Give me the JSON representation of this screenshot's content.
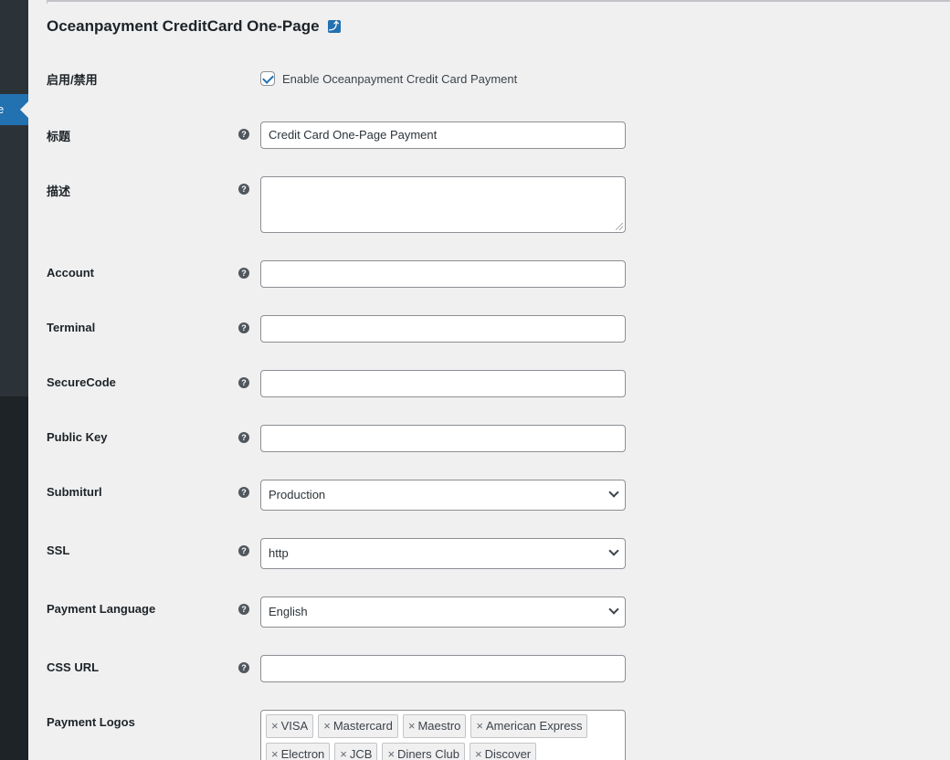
{
  "sidebar": {
    "current_item_fragment": "e"
  },
  "page": {
    "title": "Oceanpayment CreditCard One-Page",
    "back_icon_glyph": "⤴"
  },
  "help_glyph": "?",
  "fields": {
    "enable": {
      "label": "启用/禁用",
      "checkbox_label": "Enable Oceanpayment Credit Card Payment",
      "checked": true
    },
    "title": {
      "label": "标题",
      "value": "Credit Card One-Page Payment"
    },
    "description": {
      "label": "描述",
      "value": ""
    },
    "account": {
      "label": "Account",
      "value": ""
    },
    "terminal": {
      "label": "Terminal",
      "value": ""
    },
    "securecode": {
      "label": "SecureCode",
      "value": ""
    },
    "public_key": {
      "label": "Public Key",
      "value": ""
    },
    "submiturl": {
      "label": "Submiturl",
      "value": "Production"
    },
    "ssl": {
      "label": "SSL",
      "value": "http"
    },
    "payment_language": {
      "label": "Payment Language",
      "value": "English"
    },
    "css_url": {
      "label": "CSS URL",
      "value": ""
    },
    "payment_logos": {
      "label": "Payment Logos",
      "remove_glyph": "×",
      "tags": [
        "VISA",
        "Mastercard",
        "Maestro",
        "American Express",
        "Electron",
        "JCB",
        "Diners Club",
        "Discover"
      ]
    }
  },
  "colors": {
    "accent": "#2271b1",
    "sidebar": "#1d2327",
    "background": "#f0f0f1"
  }
}
